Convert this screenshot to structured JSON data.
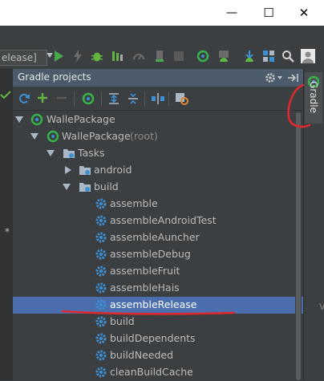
{
  "window": {
    "minimize_glyph": "—",
    "maximize_glyph": "☐",
    "close_glyph": "✕"
  },
  "toolbar": {
    "run_config_value": "elease]"
  },
  "panel": {
    "title": "Gradle projects",
    "stripe_tab_label": "Gradle"
  },
  "tree": {
    "root": "WallePackage",
    "project": "WallePackage",
    "project_suffix": "(root)",
    "tasks": "Tasks",
    "android": "android",
    "build_group": "build",
    "items": [
      "assemble",
      "assembleAndroidTest",
      "assembleAuncher",
      "assembleDebug",
      "assembleFruit",
      "assembleHais",
      "assembleRelease",
      "build",
      "buildDependents",
      "buildNeeded",
      "cleanBuildCache"
    ],
    "selected_item": "assembleRelease"
  },
  "fragments": {
    "left_code": "* *",
    "right_edge": "V"
  },
  "colors": {
    "accent_select": "#4b6eaf",
    "annotation": "#e0282d",
    "gradle_green": "#36b24a",
    "gear_blue": "#3d8fd1"
  }
}
